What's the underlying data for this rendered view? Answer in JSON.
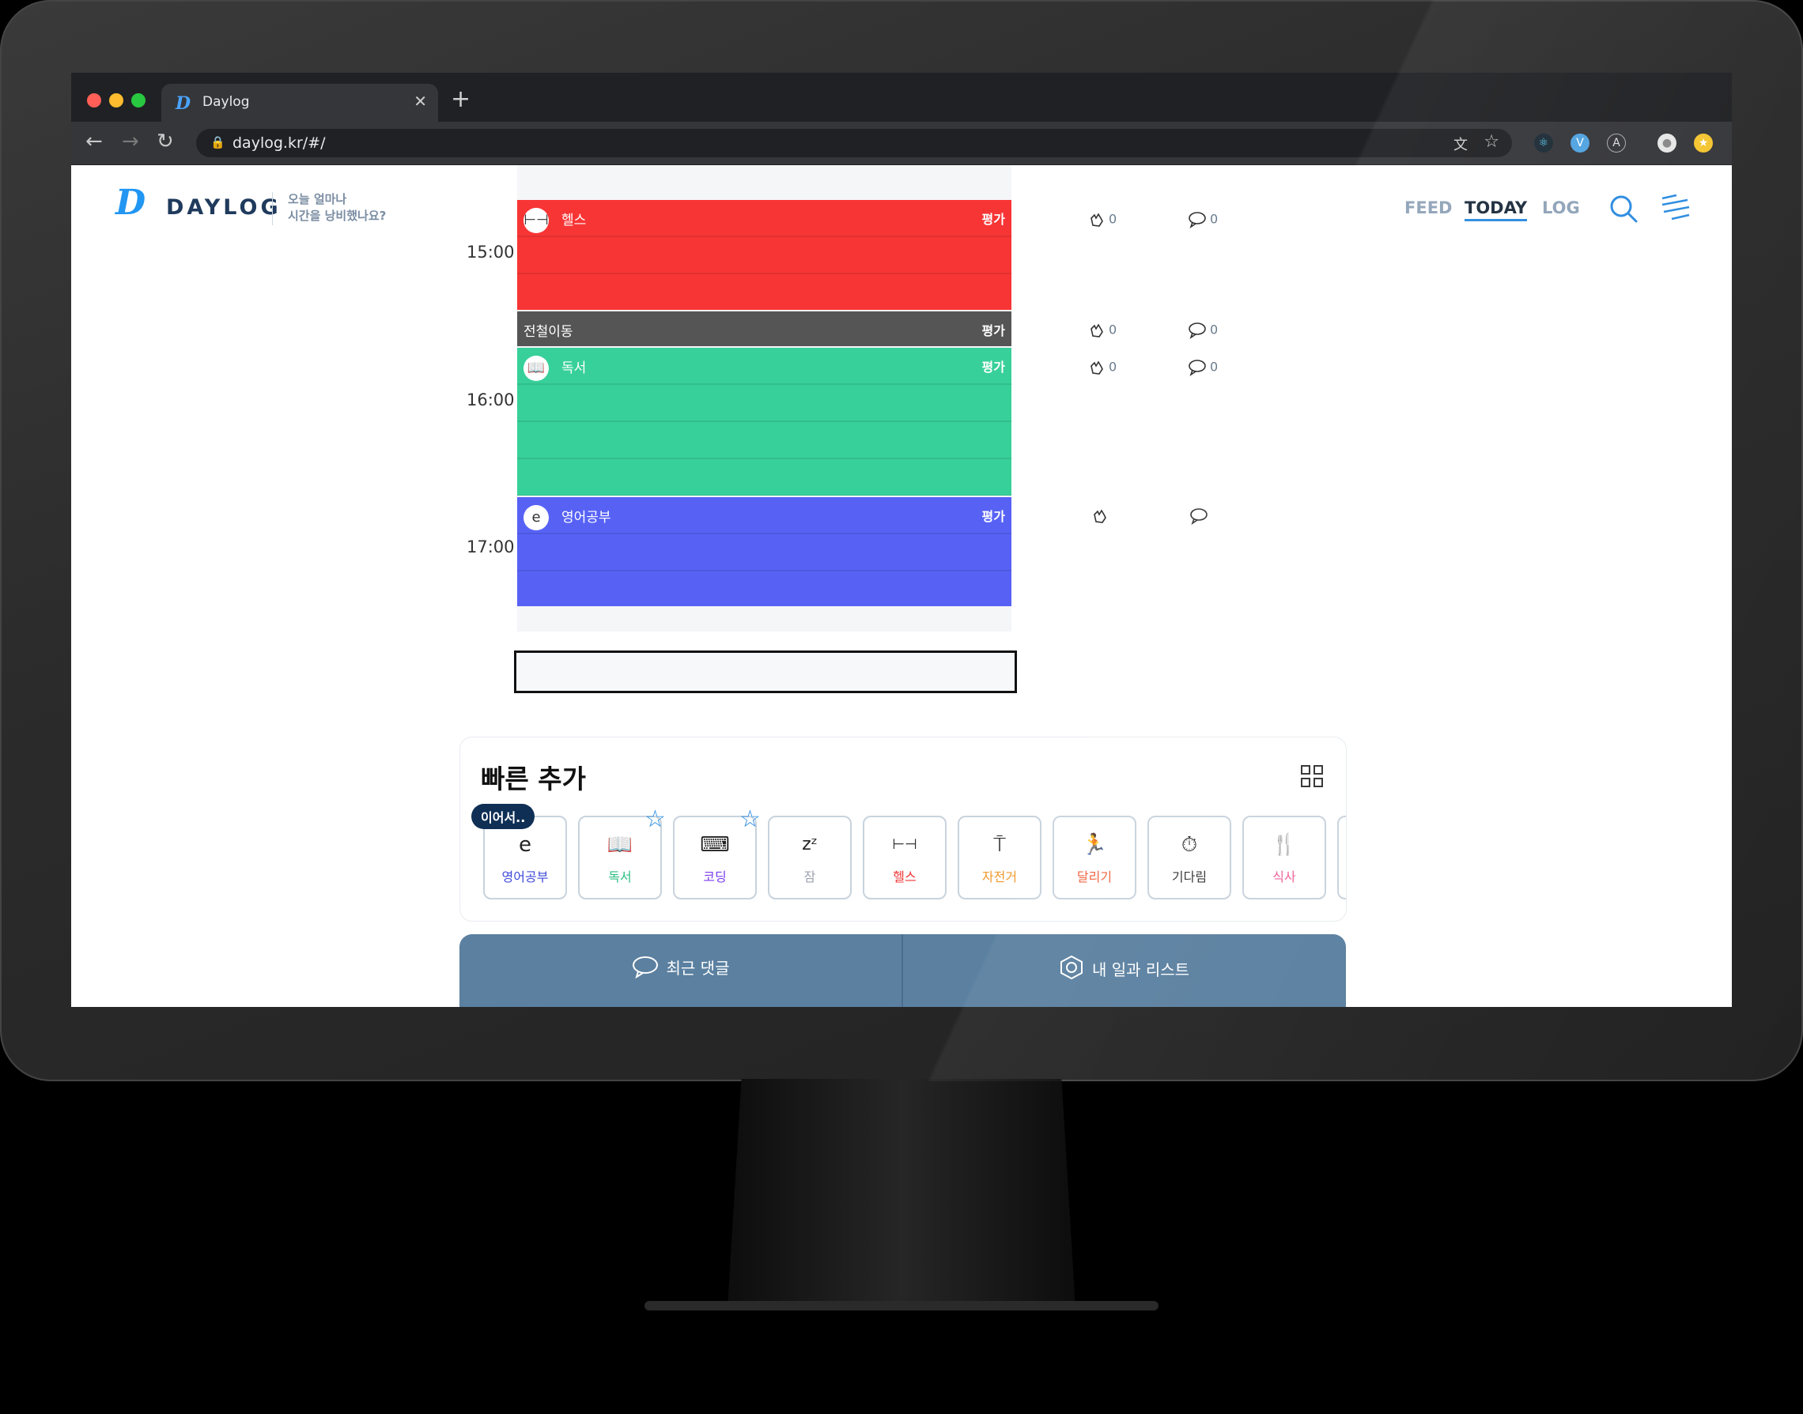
{
  "browser": {
    "tab_title": "Daylog",
    "new_tab": "+",
    "url": "daylog.kr/#/"
  },
  "header": {
    "logo_text": "DAYLOG",
    "tagline_line1": "오늘 얼마나",
    "tagline_line2": "시간을 낭비했나요?",
    "nav": {
      "feed": "FEED",
      "today": "TODAY",
      "log": "LOG"
    }
  },
  "timeline": {
    "times": [
      "15:00",
      "16:00",
      "17:00"
    ],
    "slots": [
      {
        "name": "헬스",
        "rate": "평가",
        "color": "#f73535",
        "icon": "dumbbell-icon",
        "likes": "0",
        "comments": "0"
      },
      {
        "name": "전철이동",
        "rate": "평가",
        "color": "#555555",
        "icon": "",
        "likes": "0",
        "comments": "0"
      },
      {
        "name": "독서",
        "rate": "평가",
        "color": "#38d09a",
        "icon": "book-icon",
        "likes": "0",
        "comments": "0"
      },
      {
        "name": "영어공부",
        "rate": "평가",
        "color": "#5762f5",
        "icon": "english-icon",
        "likes": "",
        "comments": ""
      }
    ]
  },
  "quick_add": {
    "title": "빠른 추가",
    "resume_badge": "이어서..",
    "items": [
      {
        "label": "영어공부",
        "color": "#3d49d8",
        "icon": "english-icon"
      },
      {
        "label": "독서",
        "color": "#2fbf82",
        "icon": "book-icon",
        "favorite": true
      },
      {
        "label": "코딩",
        "color": "#7b3cf0",
        "icon": "coding-icon",
        "favorite": true
      },
      {
        "label": "잠",
        "color": "#9aa3ad",
        "icon": "sleep-icon"
      },
      {
        "label": "헬스",
        "color": "#f03535",
        "icon": "dumbbell-icon"
      },
      {
        "label": "자전거",
        "color": "#f29a2e",
        "icon": "bicycle-icon"
      },
      {
        "label": "달리기",
        "color": "#f25f3a",
        "icon": "running-icon"
      },
      {
        "label": "기다림",
        "color": "#333333",
        "icon": "stopwatch-icon"
      },
      {
        "label": "식사",
        "color": "#f0609a",
        "icon": "meal-icon"
      }
    ]
  },
  "bottom_bar": {
    "recent_comments": "최근 댓글",
    "my_list": "내 일과 리스트"
  }
}
